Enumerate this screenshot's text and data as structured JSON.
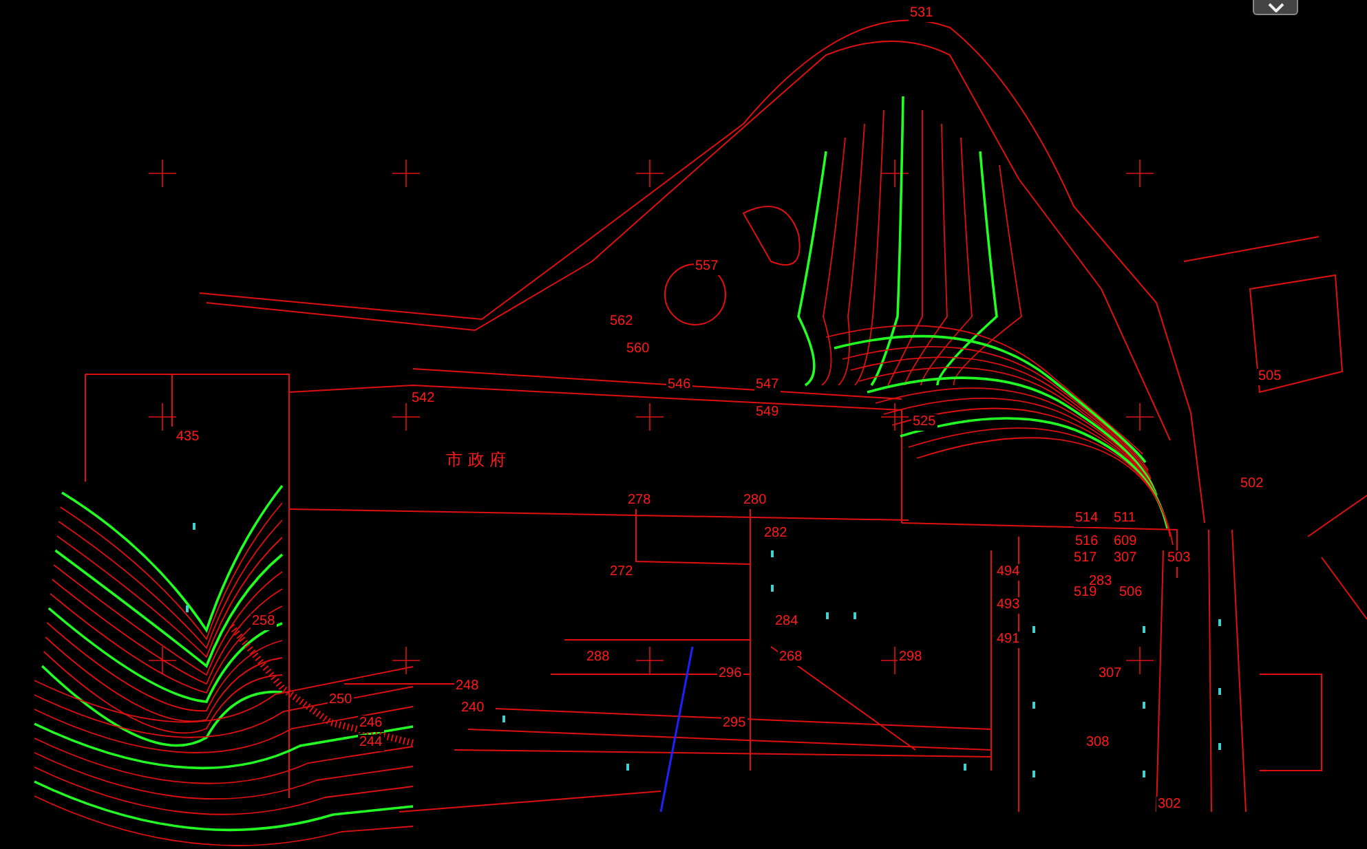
{
  "map": {
    "building_label": "市 政 府",
    "elevation_labels": [
      "531",
      "557",
      "562",
      "560",
      "505",
      "546",
      "547",
      "542",
      "549",
      "525",
      "435",
      "502",
      "278",
      "280",
      "514",
      "511",
      "282",
      "516",
      "609",
      "517",
      "307",
      "503",
      "272",
      "494",
      "283",
      "519",
      "506",
      "493",
      "258",
      "284",
      "491",
      "288",
      "268",
      "298",
      "296",
      "307",
      "248",
      "250",
      "240",
      "246",
      "295",
      "244",
      "308",
      "302"
    ]
  }
}
